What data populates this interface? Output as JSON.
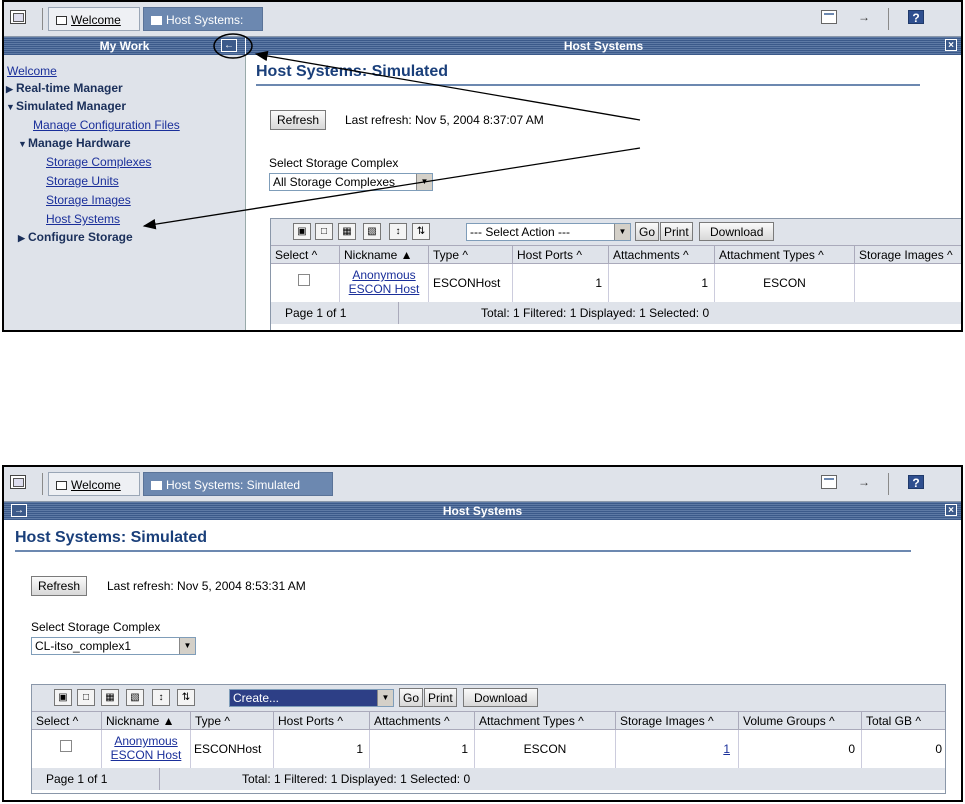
{
  "top": {
    "tabs": [
      {
        "label": "Welcome"
      },
      {
        "label": "Host Systems:"
      }
    ],
    "sidebar_title": "My Work",
    "sidebar_items": [
      {
        "label": "Welcome"
      },
      {
        "label": "Real-time Manager"
      },
      {
        "label": "Simulated Manager"
      },
      {
        "label": "Manage Configuration Files"
      },
      {
        "label": "Manage Hardware"
      },
      {
        "label": "Storage Complexes"
      },
      {
        "label": "Storage Units"
      },
      {
        "label": "Storage Images"
      },
      {
        "label": "Host Systems"
      },
      {
        "label": "Configure Storage"
      }
    ],
    "panel_title": "Host Systems",
    "page_heading": "Host Systems: Simulated",
    "refresh_label": "Refresh",
    "last_refresh": "Last refresh: Nov 5, 2004 8:37:07 AM",
    "select_label": "Select Storage Complex",
    "select_value": "All Storage Complexes",
    "action_select": "--- Select Action ---",
    "go_label": "Go",
    "print_label": "Print",
    "download_label": "Download",
    "columns": [
      "Select ^",
      "Nickname ▲",
      "Type ^",
      "Host Ports ^",
      "Attachments ^",
      "Attachment Types ^",
      "Storage Images ^"
    ],
    "row": {
      "nickname_1": "Anonymous",
      "nickname_2": "ESCON Host",
      "type": "ESCONHost",
      "host_ports": "1",
      "attachments": "1",
      "attachment_types": "ESCON",
      "storage_images": ""
    },
    "footer_page": "Page 1 of 1",
    "footer_summary": "Total: 1   Filtered: 1   Displayed: 1   Selected: 0"
  },
  "bottom": {
    "tabs": [
      {
        "label": "Welcome"
      },
      {
        "label": "Host Systems: Simulated"
      }
    ],
    "panel_title": "Host Systems",
    "page_heading": "Host Systems: Simulated",
    "refresh_label": "Refresh",
    "last_refresh": "Last refresh: Nov 5, 2004 8:53:31 AM",
    "select_label": "Select Storage Complex",
    "select_value": "CL-itso_complex1",
    "action_select": "Create...",
    "go_label": "Go",
    "print_label": "Print",
    "download_label": "Download",
    "columns": [
      "Select ^",
      "Nickname ▲",
      "Type ^",
      "Host Ports ^",
      "Attachments ^",
      "Attachment Types ^",
      "Storage Images ^",
      "Volume Groups ^",
      "Total GB ^"
    ],
    "row": {
      "nickname_1": "Anonymous",
      "nickname_2": "ESCON Host",
      "type": "ESCONHost",
      "host_ports": "1",
      "attachments": "1",
      "attachment_types": "ESCON",
      "storage_images": "1",
      "volume_groups": "0",
      "total_gb": "0"
    },
    "footer_page": "Page 1 of 1",
    "footer_summary": "Total: 1   Filtered: 1   Displayed: 1   Selected: 0"
  },
  "icons": {
    "window": "window-icon",
    "tab": "tab-page-icon",
    "monitor": "monitor-icon",
    "exit": "exit-icon",
    "help": "help-icon",
    "help_glyph": "?",
    "close_glyph": "×",
    "collapse_glyph": "←",
    "expand_glyph": "→",
    "toolbar": [
      "select-all-icon",
      "deselect-all-icon",
      "show-filter-icon",
      "clear-filter-icon",
      "edit-sort-icon",
      "clear-sort-icon"
    ]
  },
  "colors": {
    "accent": "#3c5a8a",
    "tab_active": "#6c88b0",
    "link": "#1a2f9a",
    "panel_bg": "#dfe3ea"
  }
}
